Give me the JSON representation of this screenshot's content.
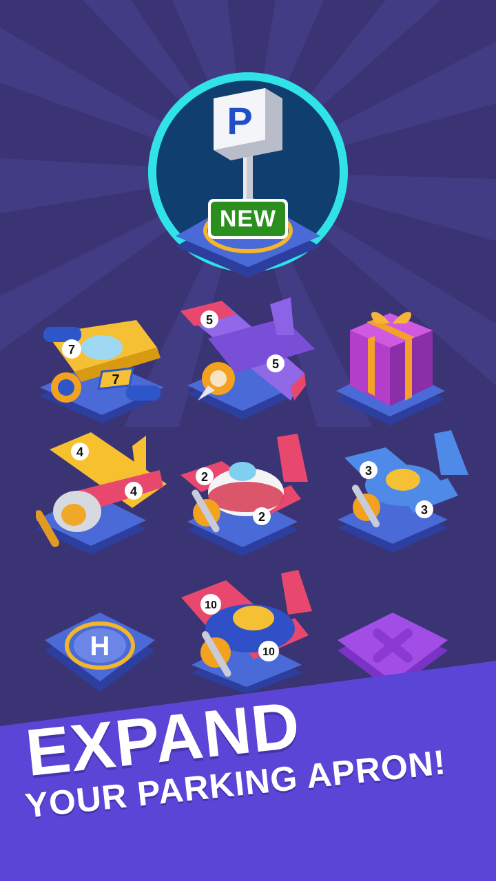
{
  "promo": {
    "headline": "EXPAND",
    "subline": "YOUR PARKING APRON!"
  },
  "badge": {
    "sign_letter": "P",
    "tag_label": "NEW",
    "icon": "parking-sign-icon"
  },
  "grid": {
    "items": [
      {
        "kind": "plane",
        "level": "7",
        "icon": "jet-plane-icon"
      },
      {
        "kind": "plane",
        "level": "5",
        "icon": "biplane-icon"
      },
      {
        "kind": "gift",
        "icon": "gift-box-icon"
      },
      {
        "kind": "plane",
        "level": "4",
        "icon": "biplane-icon"
      },
      {
        "kind": "plane",
        "level": "2",
        "icon": "propeller-plane-icon"
      },
      {
        "kind": "plane",
        "level": "3",
        "icon": "propeller-plane-icon"
      },
      {
        "kind": "helipad",
        "letter": "H",
        "icon": "helipad-icon"
      },
      {
        "kind": "plane",
        "level": "10",
        "icon": "biplane-icon"
      },
      {
        "kind": "locked",
        "icon": "close-icon"
      }
    ]
  },
  "colors": {
    "background": "#3a3474",
    "banner": "#5a45d6",
    "badge_ring": "#2fe3e8",
    "tag_green": "#2a8f1c",
    "pad_blue": "#4a63d6"
  }
}
